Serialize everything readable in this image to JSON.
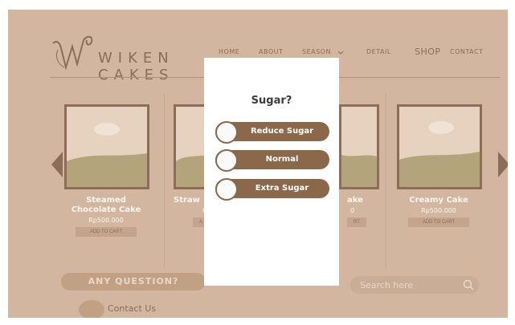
{
  "brand": {
    "line1": "WIKEN",
    "line2": "CAKES"
  },
  "nav": {
    "home": "HOME",
    "about": "ABOUT",
    "season": "SEASON",
    "detail": "DETAIL",
    "shop": "SHOP",
    "contact": "CONTACT"
  },
  "products": [
    {
      "name": "Steamed Chocolate Cake",
      "price": "Rp500.000",
      "button": "ADD TO CART"
    },
    {
      "name": "Straw",
      "price": "R",
      "button": "A"
    },
    {
      "name": "ake",
      "price": "0",
      "button": "RT"
    },
    {
      "name": "Creamy Cake",
      "price": "Rp500.000",
      "button": "ADD TO CART"
    }
  ],
  "question": "ANY QUESTION?",
  "contact": "Contact Us",
  "search": {
    "placeholder": "Search here"
  },
  "modal": {
    "title": "Sugar?",
    "options": [
      {
        "label": "Reduce Sugar"
      },
      {
        "label": "Normal"
      },
      {
        "label": "Extra Sugar"
      }
    ]
  },
  "colors": {
    "background": "#d2b69f",
    "accent": "#8c6d58",
    "option": "#8b6849",
    "modal": "#ffffff"
  }
}
